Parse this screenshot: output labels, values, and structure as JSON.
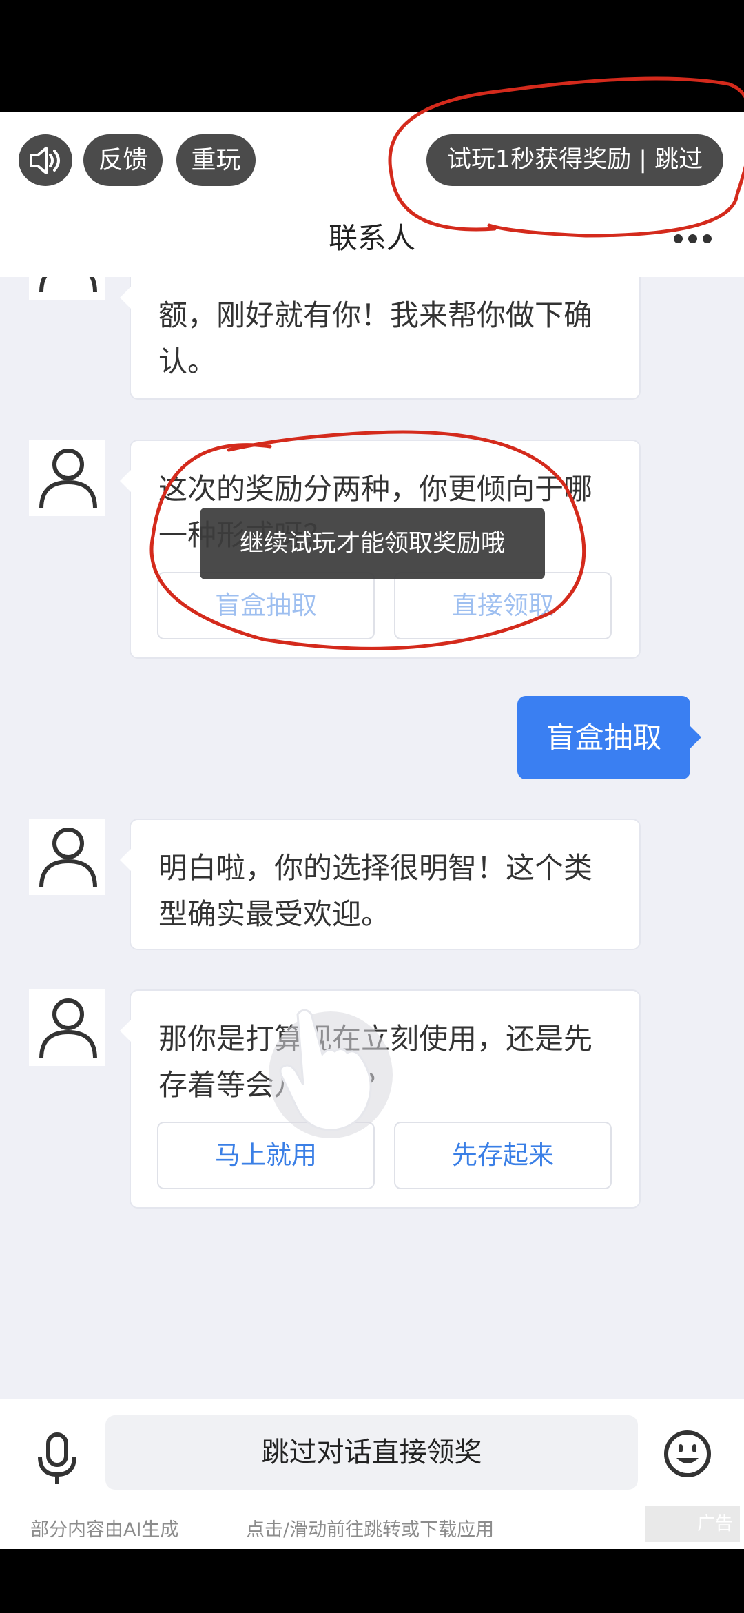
{
  "header": {
    "sound_icon": "speaker-icon",
    "feedback_label": "反馈",
    "replay_label": "重玩",
    "skip_label": "试玩1秒获得奖励 | 跳过",
    "title": "联系人",
    "more_icon": "more-dots-icon"
  },
  "messages": {
    "m1": "额，刚好就有你！我来帮你做下确认。",
    "m2": "这次的奖励分两种，你更倾向于哪一种形式呀？",
    "m2_choices": [
      "盲盒抽取",
      "直接领取"
    ],
    "user_reply": "盲盒抽取",
    "m3": "明白啦，你的选择很明智！这个类型确实最受欢迎。",
    "m4": "那你是打算现在立刻使用，还是先存着等会儿再说？",
    "m4_choices": [
      "马上就用",
      "先存起来"
    ]
  },
  "toast": "继续试玩才能领取奖励哦",
  "bottom": {
    "mic_icon": "microphone-icon",
    "input_label": "跳过对话直接领奖",
    "emoji_icon": "smiley-icon",
    "ai_note": "部分内容由AI生成",
    "hint": "点击/滑动前往跳转或下载应用",
    "ad_label": "广告"
  },
  "colors": {
    "accent": "#3a7ff2",
    "annotation": "#d42a1c"
  }
}
